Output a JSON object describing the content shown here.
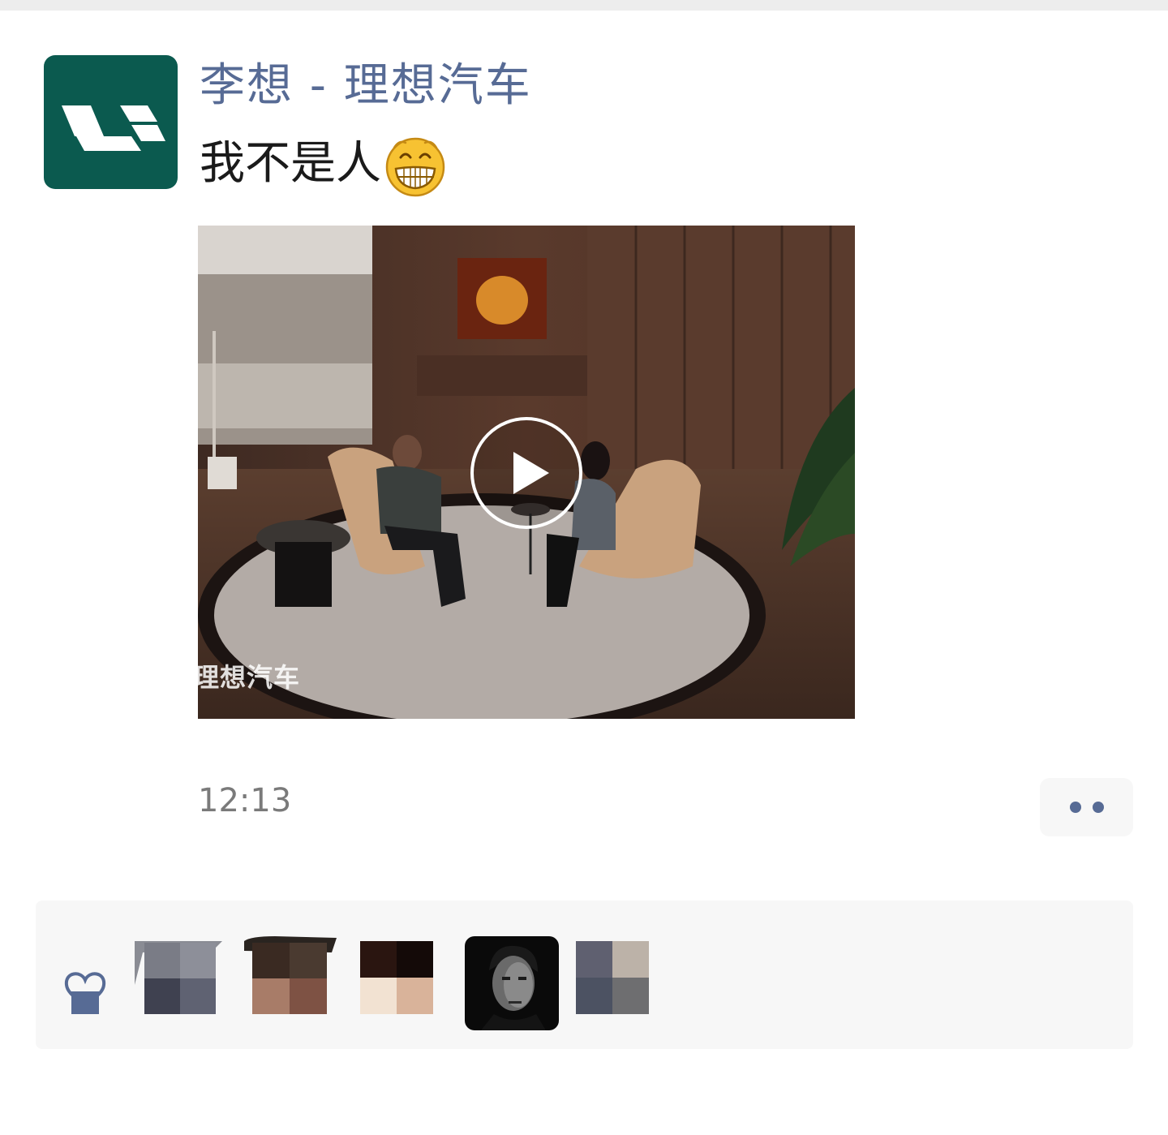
{
  "post": {
    "author": "李想 - 理想汽车",
    "text": "我不是人",
    "emoji": "grinning-face-emoji",
    "video": {
      "watermark": "理想汽车",
      "play_icon": "play-icon"
    },
    "timestamp": "12:13",
    "more_icon": "more-dots-icon"
  },
  "likes": {
    "icon": "heart-icon",
    "users": [
      {
        "avatar": "pixelated-avatar"
      },
      {
        "avatar": "pixelated-avatar"
      },
      {
        "avatar": "pixelated-avatar"
      },
      {
        "avatar": "portrait-avatar"
      },
      {
        "avatar": "pixelated-avatar"
      }
    ]
  },
  "colors": {
    "link_blue": "#576b95",
    "avatar_green": "#0b5a4f",
    "panel_bg": "#f7f7f7"
  }
}
